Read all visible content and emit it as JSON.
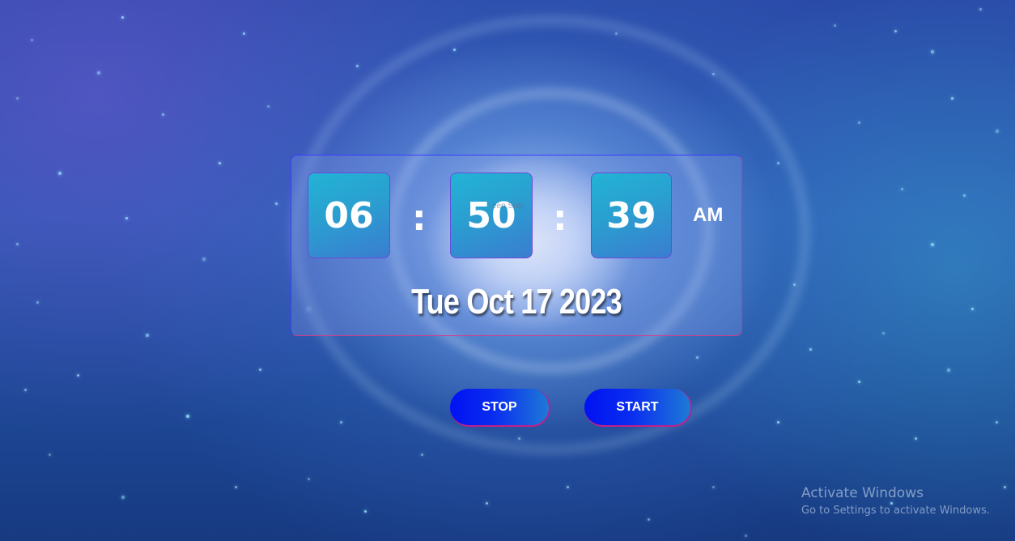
{
  "clock": {
    "hours": "06",
    "minutes": "50",
    "seconds": "39",
    "separator": ":",
    "period": "AM",
    "date": "Tue Oct 17 2023",
    "overlay_text": "een Snip"
  },
  "controls": {
    "stop_label": "STOP",
    "start_label": "START"
  },
  "watermark": {
    "title": "Activate Windows",
    "subtitle": "Go to Settings to activate Windows."
  },
  "colors": {
    "digit_box": "#22b3d6",
    "button": "#0012f2",
    "card_border": "#3a3cff"
  }
}
